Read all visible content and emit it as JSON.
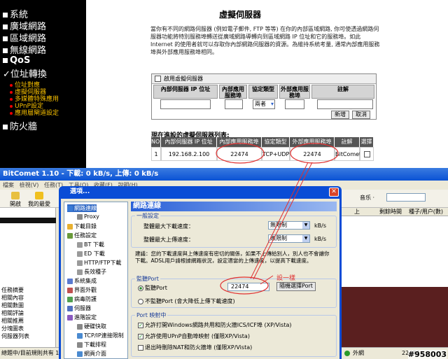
{
  "router": {
    "menu": [
      "系統",
      "廣域網路",
      "區域網路",
      "無線網路",
      "QoS",
      "位址轉換",
      "防火牆"
    ],
    "submenu": [
      "位址對應",
      "虛擬伺服器",
      "多媒體特殊應用",
      "UPnP設定",
      "應用層閘道設定"
    ],
    "page_title": "虛擬伺服器",
    "description": "當你有不同的網路伺服器 (例如電子郵件, FTP 等等) 在你的內部區域網路, 你可使透過網路伺服器功能將特別服務埠轉送從廣域網路導轉向到區域網路 IP 位址和它的服務埠。如此 Internet 的使用者就可以存取你內部網路伺服器的資源。為維持系統考量, 通常內部應用服務埠與外部應用服務埠相同。",
    "enable_label": "啟用虛擬伺服器",
    "form_headers": [
      "內部伺服器 IP 位址",
      "內部應用服務埠",
      "協定類型",
      "外部應用服務埠",
      "註解"
    ],
    "protocol_default": "兩者",
    "add_button": "新增",
    "cancel_button": "取消",
    "list_title": "現在進設的虛擬伺服器列表:",
    "list_headers": [
      "NO.",
      "內部伺服器 IP 位址",
      "內部應用服務埠",
      "協定類型",
      "外部應用服務埠",
      "註解",
      "選擇"
    ],
    "list_rows": [
      {
        "no": "1",
        "ip": "192.168.2.100",
        "internal_port": "22474",
        "protocol": "TCP+UDP",
        "external_port": "22474",
        "comment": "BitComet"
      }
    ]
  },
  "bitcomet": {
    "title": "BitComet 1.10 - 下載: 0 kB/s, 上傳: 0 kB/s",
    "menu": [
      "檔案",
      "檢視(V)",
      "任務(T)",
      "工具(O)",
      "收藏(F)",
      "說明(H)"
    ],
    "toolbar": [
      "開啟",
      "我的最愛"
    ],
    "search_label": "音乐 ·",
    "left_items": [
      "任務摘要",
      "相關內容",
      "相關數圖",
      "相關評論",
      "相關推薦",
      "分塊圖表",
      "伺服器列表"
    ],
    "right_cols": [
      "上",
      "剩餘時間",
      "種子/用户(數)"
    ],
    "status_left": "總題中/目前規則共有 1 項",
    "status_right": "外網",
    "status_port": "22474",
    "watermark": "#958003"
  },
  "dialog": {
    "title": "選項...",
    "close": "✕",
    "tree": [
      {
        "label": "網路連線",
        "icon": "globe-icon",
        "color": "#3a7bd5",
        "indent": 0
      },
      {
        "label": "Proxy",
        "icon": "proxy-icon",
        "color": "#888",
        "indent": 1
      },
      {
        "label": "下載目錄",
        "icon": "folder-icon",
        "color": "#e8b030",
        "indent": 0
      },
      {
        "label": "任務設定",
        "icon": "task-icon",
        "color": "#6a9a3a",
        "indent": 0
      },
      {
        "label": "BT 下載",
        "icon": "bt-icon",
        "color": "#9a9a9a",
        "indent": 1
      },
      {
        "label": "ED 下載",
        "icon": "ed-icon",
        "color": "#9a9a9a",
        "indent": 1
      },
      {
        "label": "HTTP/FTP下載",
        "icon": "http-icon",
        "color": "#9a9a9a",
        "indent": 1
      },
      {
        "label": "長效種子",
        "icon": "seed-icon",
        "color": "#9a9a9a",
        "indent": 1
      },
      {
        "label": "系統集成",
        "icon": "system-icon",
        "color": "#5a7ad0",
        "indent": 0
      },
      {
        "label": "界面外觀",
        "icon": "ui-icon",
        "color": "#c05050",
        "indent": 0
      },
      {
        "label": "病毒防護",
        "icon": "shield-icon",
        "color": "#50a050",
        "indent": 0
      },
      {
        "label": "伺服器",
        "icon": "server-icon",
        "color": "#5070c0",
        "indent": 0
      },
      {
        "label": "進階設定",
        "icon": "advanced-icon",
        "color": "#8a5ac0",
        "indent": 0
      },
      {
        "label": "硬碟快取",
        "icon": "disk-icon",
        "color": "#888",
        "indent": 1
      },
      {
        "label": "TCP/IP連接限制",
        "icon": "network-icon",
        "color": "#4a8ad0",
        "indent": 1
      },
      {
        "label": "下載排程",
        "icon": "schedule-icon",
        "color": "#888",
        "indent": 1
      },
      {
        "label": "網頁介面",
        "icon": "web-icon",
        "color": "#4a8ad0",
        "indent": 1
      }
    ],
    "panel_title": "網路連線",
    "general_group": "一般設定",
    "max_down_label": "整體最大下載速度：",
    "max_up_label": "整體最大上傳速度：",
    "max_down_value": "無限制",
    "max_up_value": "無限制",
    "unit": "kB/s",
    "speed_note": "建議：您的下載速度與上傳速度有密切的關係，如果不上傳給別人，別人也不會讓你下載。ADSL用戶請根據網路狀況，設定適當的上傳速度，以提高下載速度。",
    "listen_group": "監聽Port",
    "listen_port_label": "監聽Port",
    "listen_port_value": "22474",
    "random_port_button": "隨機選擇Port",
    "no_listen_label": "不監聽Port (會大降低上傳下載速度)",
    "annotation": "設一樣",
    "port_map_group": "Port 映射中",
    "opt1": "允許打開Windows網路共用和防火牆ICS/ICF埠 (XP/Vista)",
    "opt2": "允許使用UPnP自動埠映射 (僅限XP/Vista)",
    "opt3": "退出時刪除NAT和防火牆埠 (僅限XP/Vista)"
  }
}
